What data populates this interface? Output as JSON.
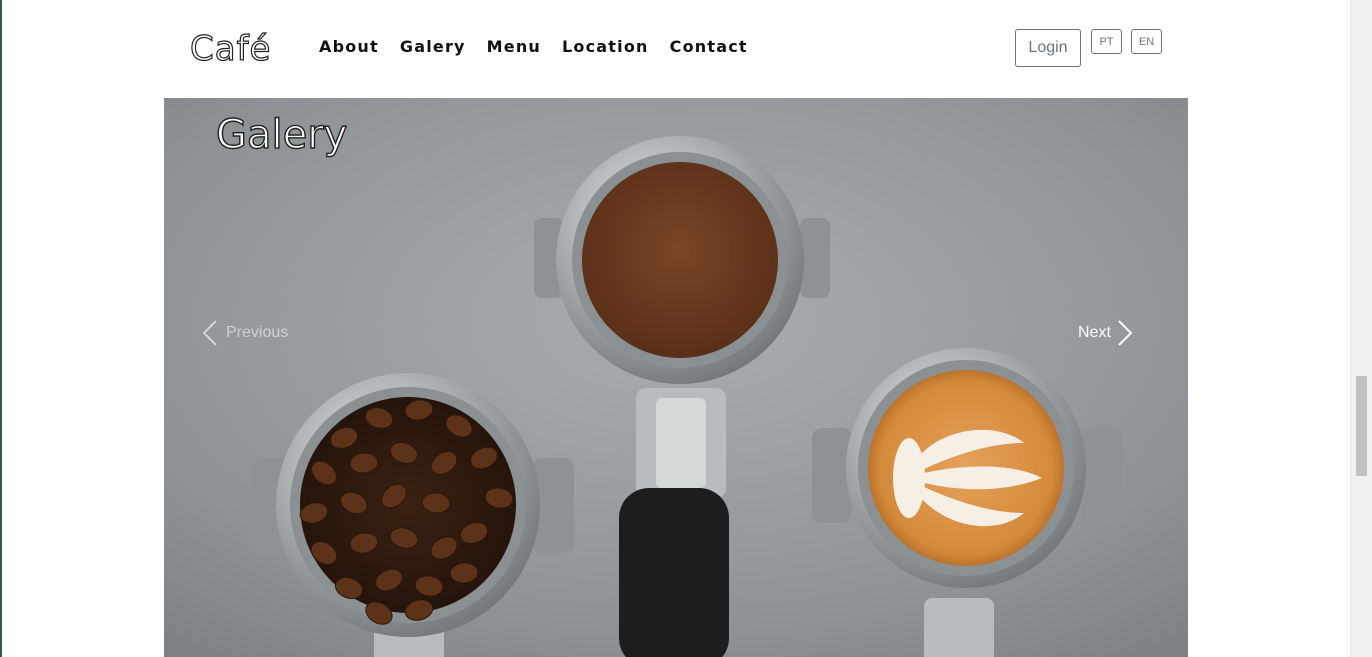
{
  "brand": {
    "logo_text": "Café"
  },
  "nav": {
    "items": [
      {
        "label": "About"
      },
      {
        "label": "Galery"
      },
      {
        "label": "Menu"
      },
      {
        "label": "Location"
      },
      {
        "label": "Contact"
      }
    ]
  },
  "actions": {
    "login_label": "Login",
    "lang_pt": "PT",
    "lang_en": "EN"
  },
  "carousel": {
    "section_title": "Galery",
    "prev_label": "Previous",
    "next_label": "Next",
    "slide_alt": "Coffee: beans, ground coffee and latte art in portafilters"
  },
  "colors": {
    "text_dark": "#111111",
    "button_border": "#6c757d",
    "carousel_bg": "#9ea3a6"
  }
}
